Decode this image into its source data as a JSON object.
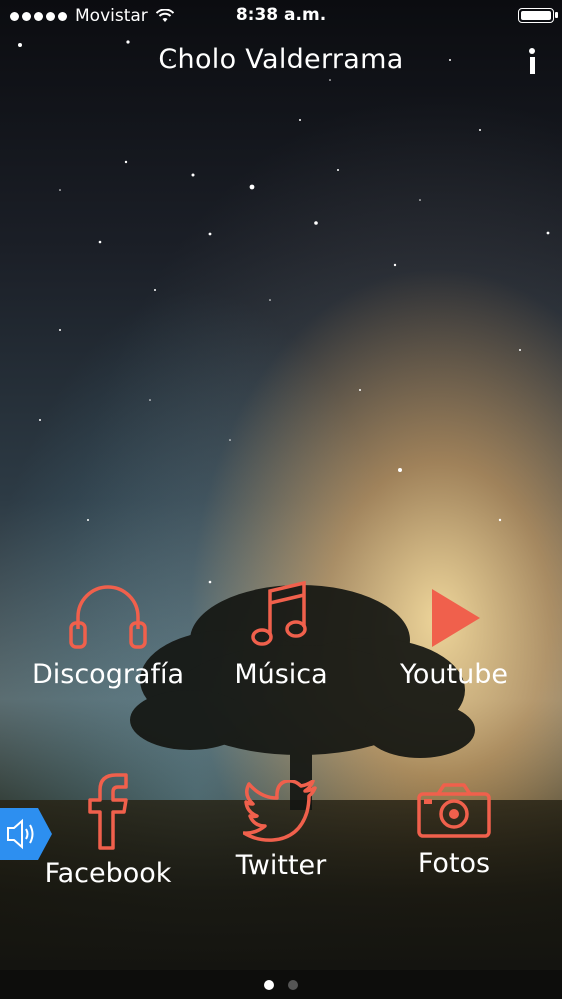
{
  "status_bar": {
    "carrier": "Movistar",
    "time": "8:38 a.m.",
    "signal_dots": 5,
    "battery_level": 1.0
  },
  "header": {
    "title": "Cholo Valderrama",
    "info_icon": "info-icon"
  },
  "menu": {
    "items": [
      {
        "label": "Discografía",
        "icon": "headphones-icon"
      },
      {
        "label": "Música",
        "icon": "music-note-icon"
      },
      {
        "label": "Youtube",
        "icon": "play-icon"
      },
      {
        "label": "Facebook",
        "icon": "facebook-icon"
      },
      {
        "label": "Twitter",
        "icon": "twitter-bird-icon"
      },
      {
        "label": "Fotos",
        "icon": "camera-icon"
      }
    ]
  },
  "sound_button": {
    "icon": "speaker-icon"
  },
  "pager": {
    "pages": 2,
    "active_page": 1
  },
  "colors": {
    "accent": "#f0604c",
    "sound_button": "#2d8ff0"
  }
}
